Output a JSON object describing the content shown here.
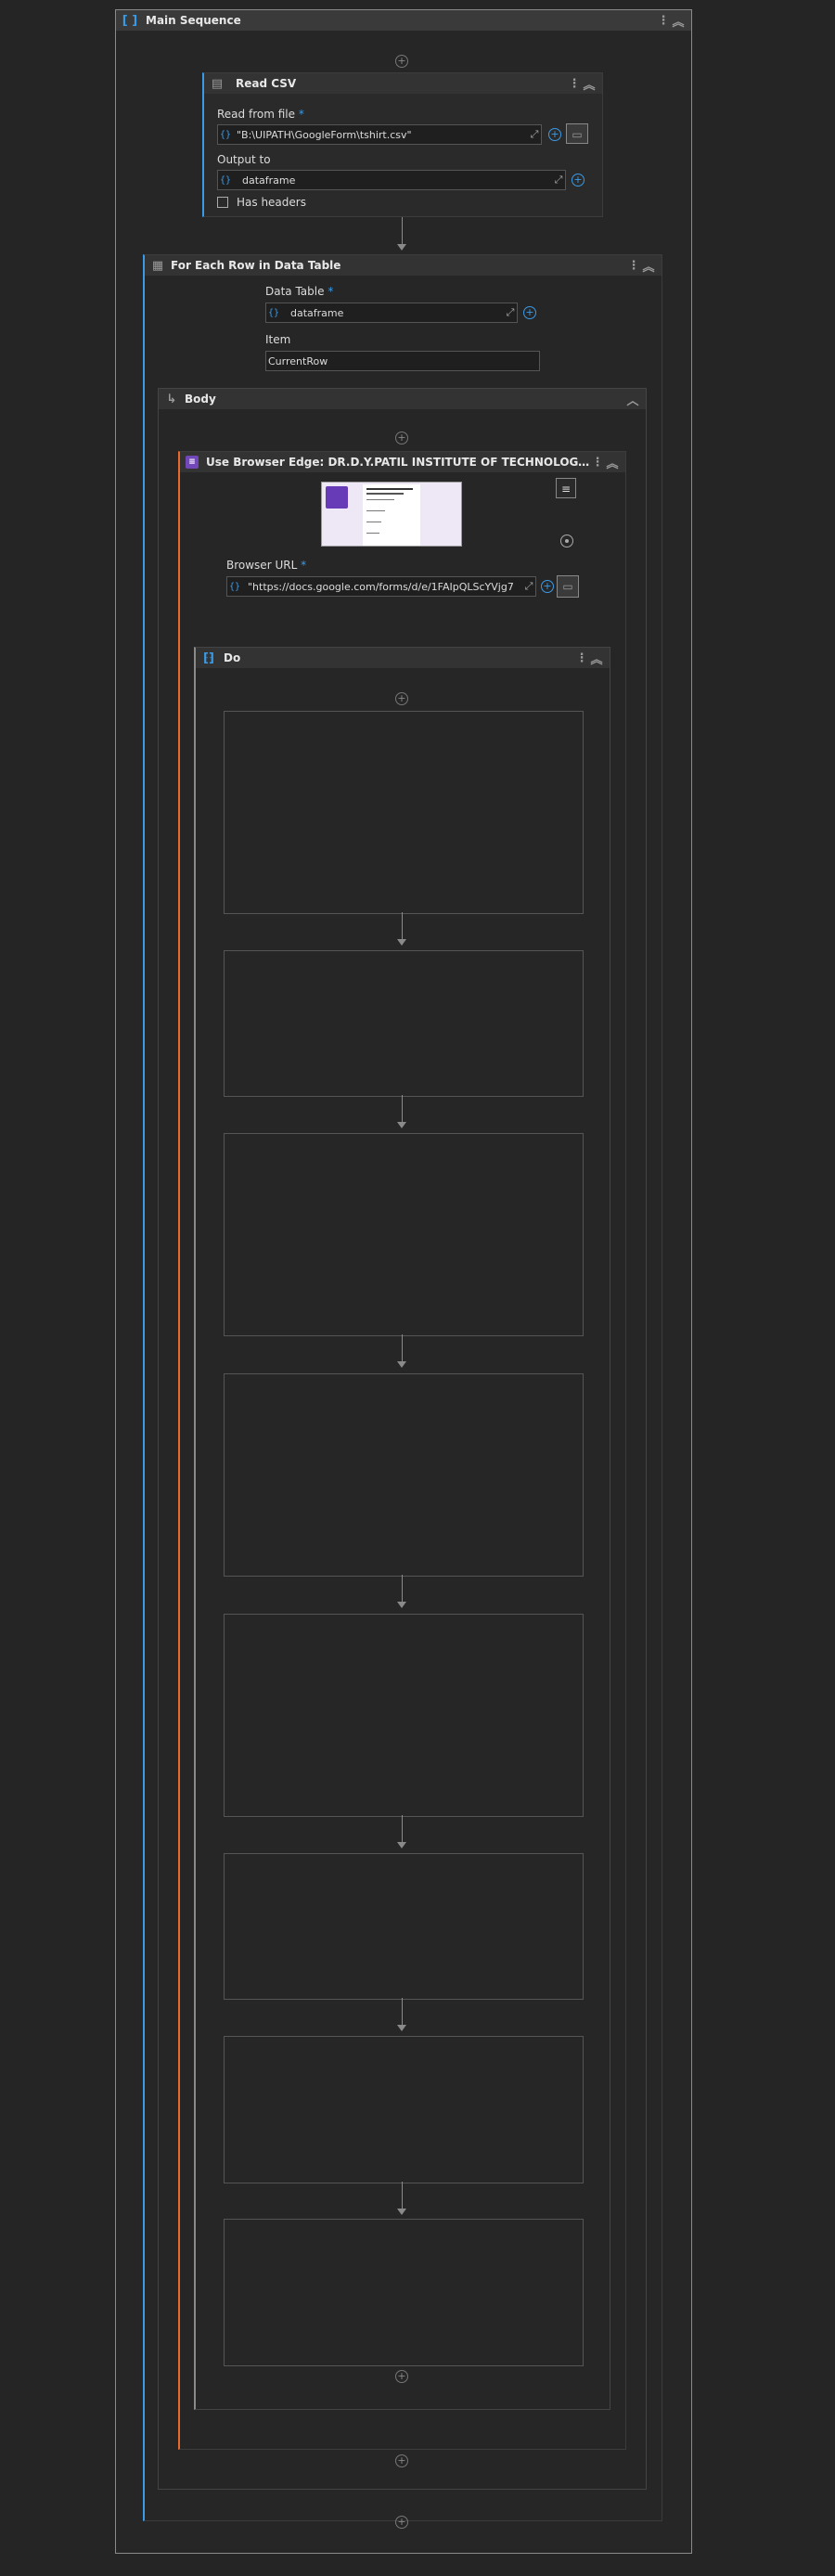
{
  "main": {
    "title": "Main Sequence"
  },
  "read_csv": {
    "title": "Read CSV",
    "read_from_file_label": "Read from file",
    "required_mark": "*",
    "read_from_file_value": "\"B:\\UIPATH\\GoogleForm\\tshirt.csv\"",
    "output_to_label": "Output to",
    "output_to_value": "dataframe",
    "has_headers_label": "Has headers"
  },
  "for_each": {
    "title": "For Each Row in Data Table",
    "data_table_label": "Data Table",
    "required_mark": "*",
    "data_table_value": "dataframe",
    "item_label": "Item",
    "item_value": "CurrentRow"
  },
  "body": {
    "title": "Body"
  },
  "browser": {
    "title": "Use Browser Edge: DR.D.Y.PATIL INSTITUTE OF TECHNOLOGY PIMPRI, P...",
    "url_label": "Browser URL",
    "required_mark": "*",
    "url_value": "\"https://docs.google.com/forms/d/e/1FAIpQLScYVjg7"
  },
  "do": {
    "title": "Do"
  },
  "colors": {
    "accent": "#3b9ae6",
    "browser_accent": "#e8692c",
    "header_bg": "#333333"
  }
}
